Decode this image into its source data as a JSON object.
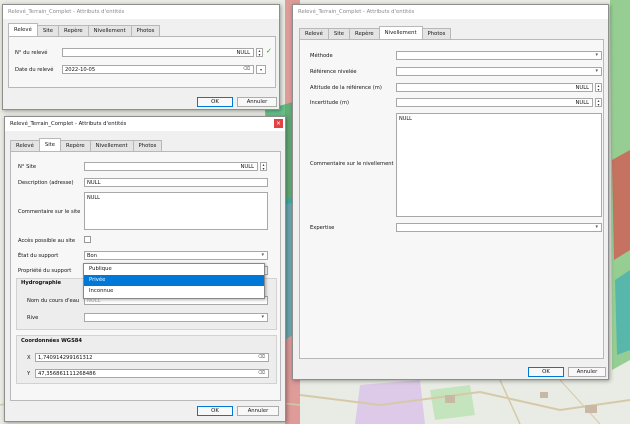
{
  "colors": {
    "accent": "#0078d7",
    "close": "#e04343",
    "check_ok": "#1f9d2d"
  },
  "window_main": {
    "title": "Relevé_Terrain_Complet - Attributs d'entités",
    "tabs": [
      "Relevé",
      "Site",
      "Repère",
      "Nivellement",
      "Photos"
    ],
    "fields": {
      "num_label": "N° du relevé",
      "num_value": "NULL",
      "date_label": "Date du relevé",
      "date_value": "2022-10-05"
    },
    "ok": "OK",
    "cancel": "Annuler"
  },
  "window_site": {
    "title": "Relevé_Terrain_Complet - Attributs d'entités",
    "close": "×",
    "tabs": [
      "Relevé",
      "Site",
      "Repère",
      "Nivellement",
      "Photos"
    ],
    "fields": {
      "num_site_label": "N° Site",
      "num_site_value": "NULL",
      "desc_label": "Description (adresse)",
      "desc_value": "NULL",
      "comment_label": "Commentaire sur le site",
      "comment_value": "NULL",
      "access_label": "Accès possible au site",
      "state_label": "État du support",
      "state_value": "Bon",
      "owner_label": "Propriété du support"
    },
    "dropdown": {
      "options": [
        "Publique",
        "Privée",
        "Inconnue"
      ],
      "selected": "Privée"
    },
    "hydro": {
      "title": "Hydrographie",
      "river_label": "Nom du cours d'eau",
      "river_placeholder": "NULL",
      "bank_label": "Rive"
    },
    "coords": {
      "title": "Coordonnées WGS84",
      "x_label": "X",
      "x_value": "1,740914299161312",
      "y_label": "Y",
      "y_value": "47,356861111268486"
    },
    "ok": "OK",
    "cancel": "Annuler"
  },
  "window_niv": {
    "title": "Relevé_Terrain_Complet - Attributs d'entités",
    "tabs": [
      "Relevé",
      "Site",
      "Repère",
      "Nivellement",
      "Photos"
    ],
    "fields": {
      "method_label": "Méthode",
      "ref_label": "Référence nivelée",
      "alt_label": "Altitude de la référence (m)",
      "alt_value": "NULL",
      "unc_label": "Incertitude (m)",
      "unc_value": "NULL",
      "comment_label": "Commentaire sur le nivellement",
      "comment_value": "NULL",
      "expertise_label": "Expertise"
    },
    "ok": "OK",
    "cancel": "Annuler"
  }
}
